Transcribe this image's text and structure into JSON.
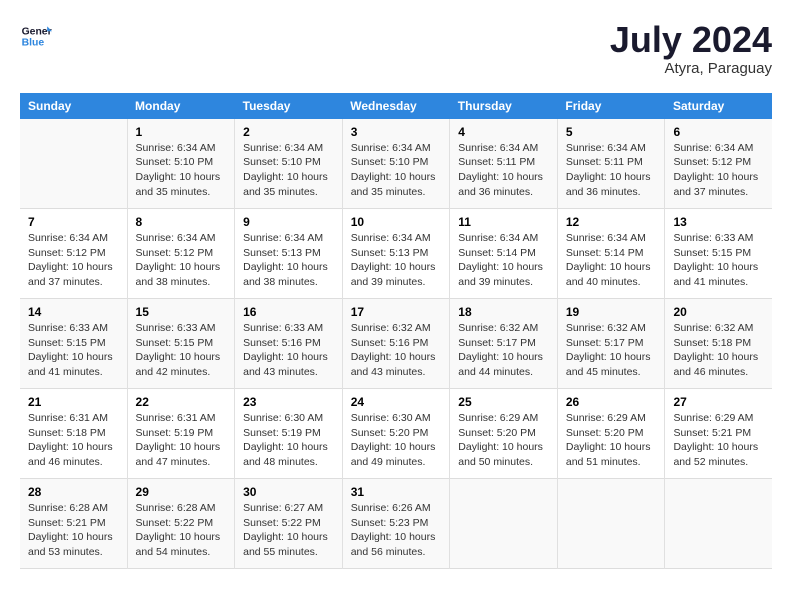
{
  "header": {
    "logo_line1": "General",
    "logo_line2": "Blue",
    "month": "July 2024",
    "location": "Atyra, Paraguay"
  },
  "days_of_week": [
    "Sunday",
    "Monday",
    "Tuesday",
    "Wednesday",
    "Thursday",
    "Friday",
    "Saturday"
  ],
  "weeks": [
    [
      {
        "day": "",
        "info": ""
      },
      {
        "day": "1",
        "info": "Sunrise: 6:34 AM\nSunset: 5:10 PM\nDaylight: 10 hours\nand 35 minutes."
      },
      {
        "day": "2",
        "info": "Sunrise: 6:34 AM\nSunset: 5:10 PM\nDaylight: 10 hours\nand 35 minutes."
      },
      {
        "day": "3",
        "info": "Sunrise: 6:34 AM\nSunset: 5:10 PM\nDaylight: 10 hours\nand 35 minutes."
      },
      {
        "day": "4",
        "info": "Sunrise: 6:34 AM\nSunset: 5:11 PM\nDaylight: 10 hours\nand 36 minutes."
      },
      {
        "day": "5",
        "info": "Sunrise: 6:34 AM\nSunset: 5:11 PM\nDaylight: 10 hours\nand 36 minutes."
      },
      {
        "day": "6",
        "info": "Sunrise: 6:34 AM\nSunset: 5:12 PM\nDaylight: 10 hours\nand 37 minutes."
      }
    ],
    [
      {
        "day": "7",
        "info": "Sunrise: 6:34 AM\nSunset: 5:12 PM\nDaylight: 10 hours\nand 37 minutes."
      },
      {
        "day": "8",
        "info": "Sunrise: 6:34 AM\nSunset: 5:12 PM\nDaylight: 10 hours\nand 38 minutes."
      },
      {
        "day": "9",
        "info": "Sunrise: 6:34 AM\nSunset: 5:13 PM\nDaylight: 10 hours\nand 38 minutes."
      },
      {
        "day": "10",
        "info": "Sunrise: 6:34 AM\nSunset: 5:13 PM\nDaylight: 10 hours\nand 39 minutes."
      },
      {
        "day": "11",
        "info": "Sunrise: 6:34 AM\nSunset: 5:14 PM\nDaylight: 10 hours\nand 39 minutes."
      },
      {
        "day": "12",
        "info": "Sunrise: 6:34 AM\nSunset: 5:14 PM\nDaylight: 10 hours\nand 40 minutes."
      },
      {
        "day": "13",
        "info": "Sunrise: 6:33 AM\nSunset: 5:15 PM\nDaylight: 10 hours\nand 41 minutes."
      }
    ],
    [
      {
        "day": "14",
        "info": "Sunrise: 6:33 AM\nSunset: 5:15 PM\nDaylight: 10 hours\nand 41 minutes."
      },
      {
        "day": "15",
        "info": "Sunrise: 6:33 AM\nSunset: 5:15 PM\nDaylight: 10 hours\nand 42 minutes."
      },
      {
        "day": "16",
        "info": "Sunrise: 6:33 AM\nSunset: 5:16 PM\nDaylight: 10 hours\nand 43 minutes."
      },
      {
        "day": "17",
        "info": "Sunrise: 6:32 AM\nSunset: 5:16 PM\nDaylight: 10 hours\nand 43 minutes."
      },
      {
        "day": "18",
        "info": "Sunrise: 6:32 AM\nSunset: 5:17 PM\nDaylight: 10 hours\nand 44 minutes."
      },
      {
        "day": "19",
        "info": "Sunrise: 6:32 AM\nSunset: 5:17 PM\nDaylight: 10 hours\nand 45 minutes."
      },
      {
        "day": "20",
        "info": "Sunrise: 6:32 AM\nSunset: 5:18 PM\nDaylight: 10 hours\nand 46 minutes."
      }
    ],
    [
      {
        "day": "21",
        "info": "Sunrise: 6:31 AM\nSunset: 5:18 PM\nDaylight: 10 hours\nand 46 minutes."
      },
      {
        "day": "22",
        "info": "Sunrise: 6:31 AM\nSunset: 5:19 PM\nDaylight: 10 hours\nand 47 minutes."
      },
      {
        "day": "23",
        "info": "Sunrise: 6:30 AM\nSunset: 5:19 PM\nDaylight: 10 hours\nand 48 minutes."
      },
      {
        "day": "24",
        "info": "Sunrise: 6:30 AM\nSunset: 5:20 PM\nDaylight: 10 hours\nand 49 minutes."
      },
      {
        "day": "25",
        "info": "Sunrise: 6:29 AM\nSunset: 5:20 PM\nDaylight: 10 hours\nand 50 minutes."
      },
      {
        "day": "26",
        "info": "Sunrise: 6:29 AM\nSunset: 5:20 PM\nDaylight: 10 hours\nand 51 minutes."
      },
      {
        "day": "27",
        "info": "Sunrise: 6:29 AM\nSunset: 5:21 PM\nDaylight: 10 hours\nand 52 minutes."
      }
    ],
    [
      {
        "day": "28",
        "info": "Sunrise: 6:28 AM\nSunset: 5:21 PM\nDaylight: 10 hours\nand 53 minutes."
      },
      {
        "day": "29",
        "info": "Sunrise: 6:28 AM\nSunset: 5:22 PM\nDaylight: 10 hours\nand 54 minutes."
      },
      {
        "day": "30",
        "info": "Sunrise: 6:27 AM\nSunset: 5:22 PM\nDaylight: 10 hours\nand 55 minutes."
      },
      {
        "day": "31",
        "info": "Sunrise: 6:26 AM\nSunset: 5:23 PM\nDaylight: 10 hours\nand 56 minutes."
      },
      {
        "day": "",
        "info": ""
      },
      {
        "day": "",
        "info": ""
      },
      {
        "day": "",
        "info": ""
      }
    ]
  ]
}
